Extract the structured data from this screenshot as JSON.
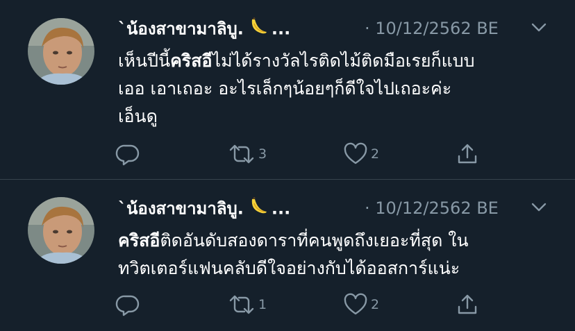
{
  "colors": {
    "background": "#15202b",
    "text": "#ffffff",
    "muted": "#8899a6",
    "divider": "#38444d"
  },
  "tweets": [
    {
      "author_name": "`น้องสาขามาลิบู.",
      "emoji": "banana-emoji",
      "ellipsis": "...",
      "meta": "· 10/12/2562 BE",
      "text_bold": "",
      "text_line1_prefix": "เห็นปีนี้",
      "text_line1_bold": "คริสอี",
      "text_line1_rest": "ไม่ได้รางวัลไรติดไม้ติดมือเรยก็แบบ",
      "text_line2": "เออ เอาเถอะ อะไรเล็กๆน้อยๆก็ดีใจไปเถอะค่ะ",
      "text_line3": "เอ็นดู",
      "reply_count": "",
      "retweet_count": "3",
      "like_count": "2",
      "icons": [
        "reply-icon",
        "retweet-icon",
        "like-icon",
        "share-icon"
      ]
    },
    {
      "author_name": "`น้องสาขามาลิบู.",
      "emoji": "banana-emoji",
      "ellipsis": "...",
      "meta": "· 10/12/2562 BE",
      "text_line1_bold": "คริสอี",
      "text_line1_rest": "ติดอันดับสองดาราที่คนพูดถึงเยอะที่สุด ใน",
      "text_line2": "ทวิตเตอร์แฟนคลับดีใจอย่างกับได้ออสการ์แน่ะ",
      "reply_count": "",
      "retweet_count": "1",
      "like_count": "2",
      "icons": [
        "reply-icon",
        "retweet-icon",
        "like-icon",
        "share-icon"
      ]
    }
  ]
}
